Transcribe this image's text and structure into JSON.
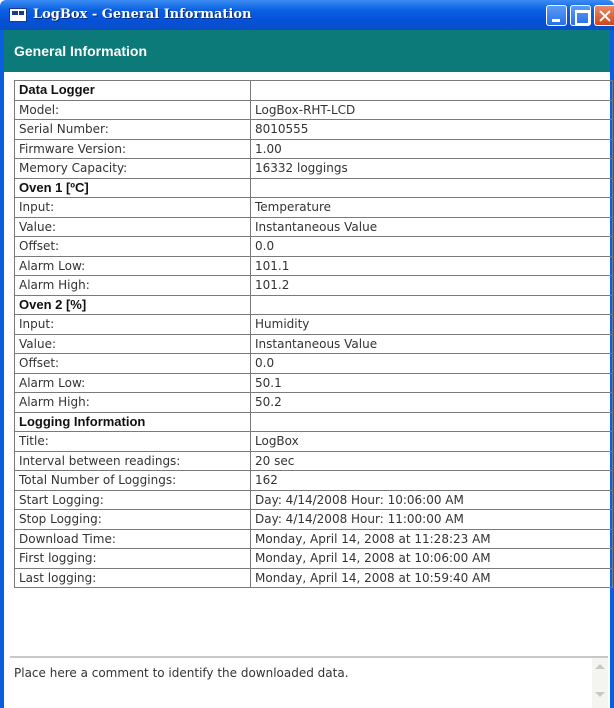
{
  "window": {
    "title": "LogBox - General Information",
    "icon": "logbox-app-icon",
    "controls": [
      "minimize-icon",
      "maximize-icon",
      "close-icon"
    ]
  },
  "header": {
    "title": "General Information"
  },
  "sections": [
    {
      "heading": "Data Logger",
      "rows": [
        {
          "label": "Model:",
          "value": "LogBox-RHT-LCD"
        },
        {
          "label": "Serial Number:",
          "value": "8010555"
        },
        {
          "label": "Firmware Version:",
          "value": "1.00"
        },
        {
          "label": "Memory Capacity:",
          "value": "16332 loggings"
        }
      ]
    },
    {
      "heading": "Oven 1 [ºC]",
      "rows": [
        {
          "label": "Input:",
          "value": "Temperature"
        },
        {
          "label": "Value:",
          "value": "Instantaneous Value"
        },
        {
          "label": "Offset:",
          "value": "0.0"
        },
        {
          "label": "Alarm Low:",
          "value": "101.1"
        },
        {
          "label": "Alarm High:",
          "value": "101.2"
        }
      ]
    },
    {
      "heading": "Oven 2 [%]",
      "rows": [
        {
          "label": "Input:",
          "value": "Humidity"
        },
        {
          "label": "Value:",
          "value": "Instantaneous Value"
        },
        {
          "label": "Offset:",
          "value": "0.0"
        },
        {
          "label": "Alarm Low:",
          "value": "50.1"
        },
        {
          "label": "Alarm High:",
          "value": "50.2"
        }
      ]
    },
    {
      "heading": "Logging Information",
      "rows": [
        {
          "label": "Title:",
          "value": "LogBox"
        },
        {
          "label": "Interval between readings:",
          "value": "20 sec"
        },
        {
          "label": "Total Number of Loggings:",
          "value": "162"
        },
        {
          "label": "Start Logging:",
          "value": "Day: 4/14/2008 Hour: 10:06:00 AM"
        },
        {
          "label": "Stop Logging:",
          "value": "Day: 4/14/2008 Hour: 11:00:00 AM"
        },
        {
          "label": "Download Time:",
          "value": "Monday, April 14, 2008 at 11:28:23 AM"
        },
        {
          "label": "First logging:",
          "value": "Monday, April 14, 2008 at 10:06:00 AM"
        },
        {
          "label": "Last logging:",
          "value": "Monday, April 14, 2008 at 10:59:40 AM"
        }
      ]
    }
  ],
  "comment": {
    "text": "Place here a comment to identify the downloaded data."
  },
  "colors": {
    "titlebar": "#0550d8",
    "header_band": "#0b7a78",
    "table_border": "#7a7a7a",
    "close_button": "#d0461e"
  }
}
